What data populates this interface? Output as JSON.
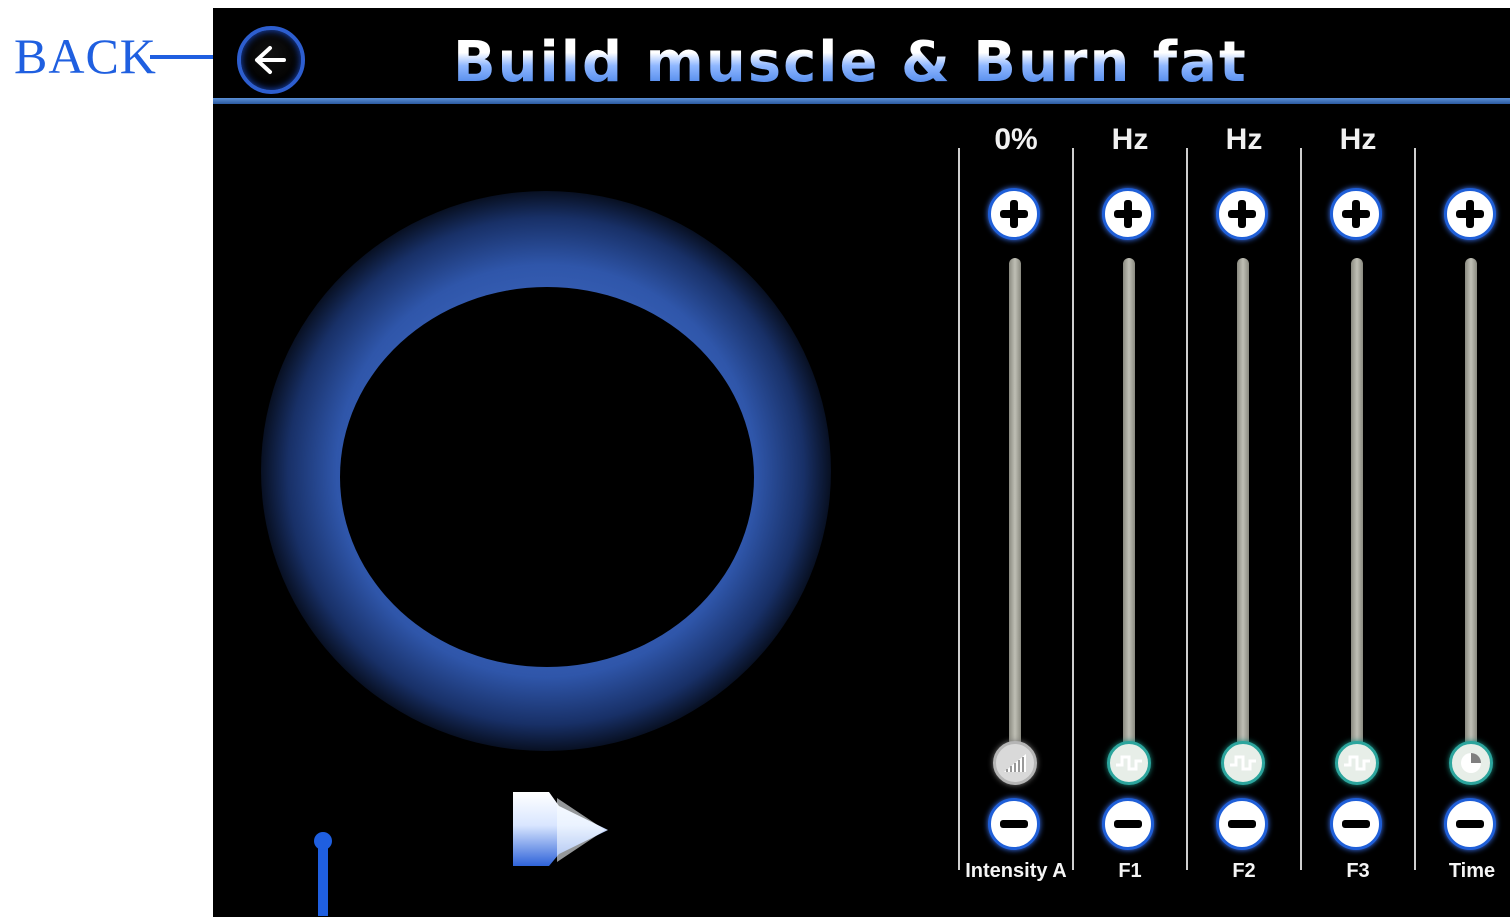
{
  "annotation": {
    "back_label": "BACK"
  },
  "header": {
    "title": "Build muscle & Burn fat"
  },
  "colors": {
    "annotation": "#1f5fe0",
    "header_rule": "#5b8fd6",
    "halo": "#3860b6",
    "knob_accent": "#2ca59d"
  },
  "icons": {
    "back": "back-arrow-icon",
    "play": "play-icon",
    "plus": "plus-icon",
    "minus": "minus-icon"
  },
  "controls": [
    {
      "key": "intensity",
      "value": "0%",
      "label": "Intensity A",
      "level": 0
    },
    {
      "key": "f1",
      "value": "Hz",
      "label": "F1",
      "level": 0
    },
    {
      "key": "f2",
      "value": "Hz",
      "label": "F2",
      "level": 0
    },
    {
      "key": "f3",
      "value": "Hz",
      "label": "F3",
      "level": 0
    },
    {
      "key": "time",
      "value": "",
      "label": "Time",
      "level": 0
    }
  ]
}
